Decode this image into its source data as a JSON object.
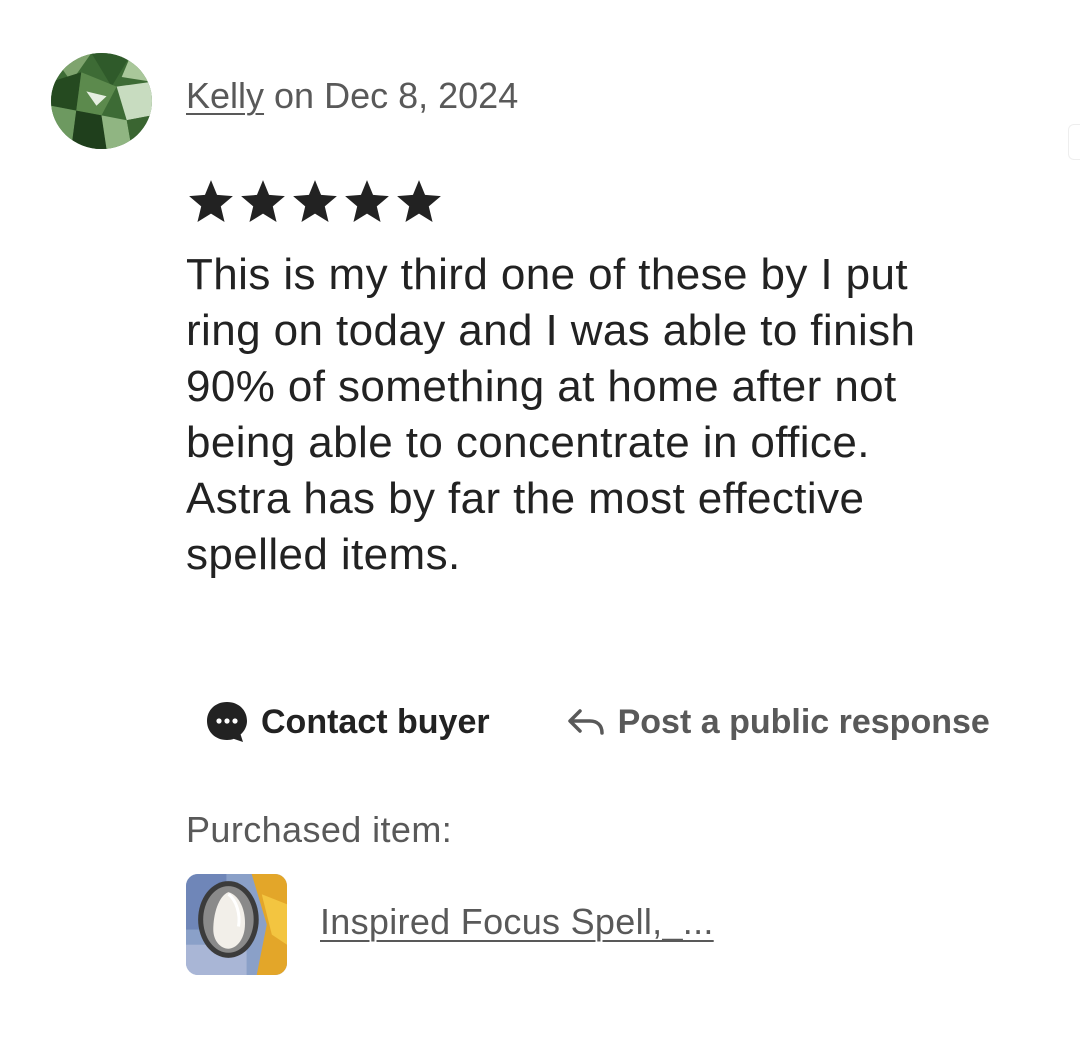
{
  "review": {
    "reviewer_name": "Kelly",
    "date_text": " on Dec 8, 2024",
    "rating": 5,
    "rating_max": 5,
    "text_lines": [
      "This is my third one of these by I put",
      "ring on today and I was able to finish",
      "90% of something at home after not",
      "being able to concentrate in office.",
      "Astra has by far the most effective",
      "spelled items."
    ]
  },
  "actions": {
    "contact_label": "Contact buyer",
    "post_label": "Post a public response"
  },
  "purchased": {
    "label": "Purchased item:",
    "item_title": "Inspired Focus Spell,_..."
  },
  "icons": {
    "avatar": "reviewer-avatar-green-moss",
    "star": "star-icon",
    "contact": "chat-bubble-icon",
    "post": "reply-arrow-icon"
  },
  "colors": {
    "primary_text": "#222222",
    "secondary_text": "#595959",
    "star": "#222222"
  }
}
